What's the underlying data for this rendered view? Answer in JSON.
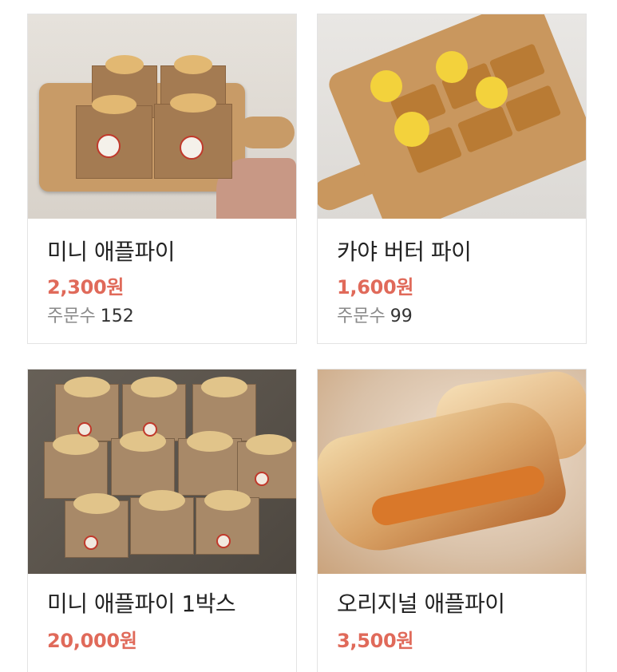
{
  "products": [
    {
      "title": "미니 애플파이",
      "price": "2,300원",
      "orders_label": "주문수",
      "orders_value": "152",
      "image": "mini-apple-pie-photo"
    },
    {
      "title": "카야 버터 파이",
      "price": "1,600원",
      "orders_label": "주문수",
      "orders_value": "99",
      "image": "kaya-butter-pie-photo"
    },
    {
      "title": "미니 애플파이 1박스",
      "price": "20,000원",
      "image": "mini-apple-pie-box-photo"
    },
    {
      "title": "오리지널 애플파이",
      "price": "3,500원",
      "image": "original-apple-pie-photo"
    }
  ],
  "colors": {
    "price": "#e06a5a",
    "title": "#222222",
    "orders_label": "#8a8a8a",
    "card_border": "#e3e3e3"
  }
}
